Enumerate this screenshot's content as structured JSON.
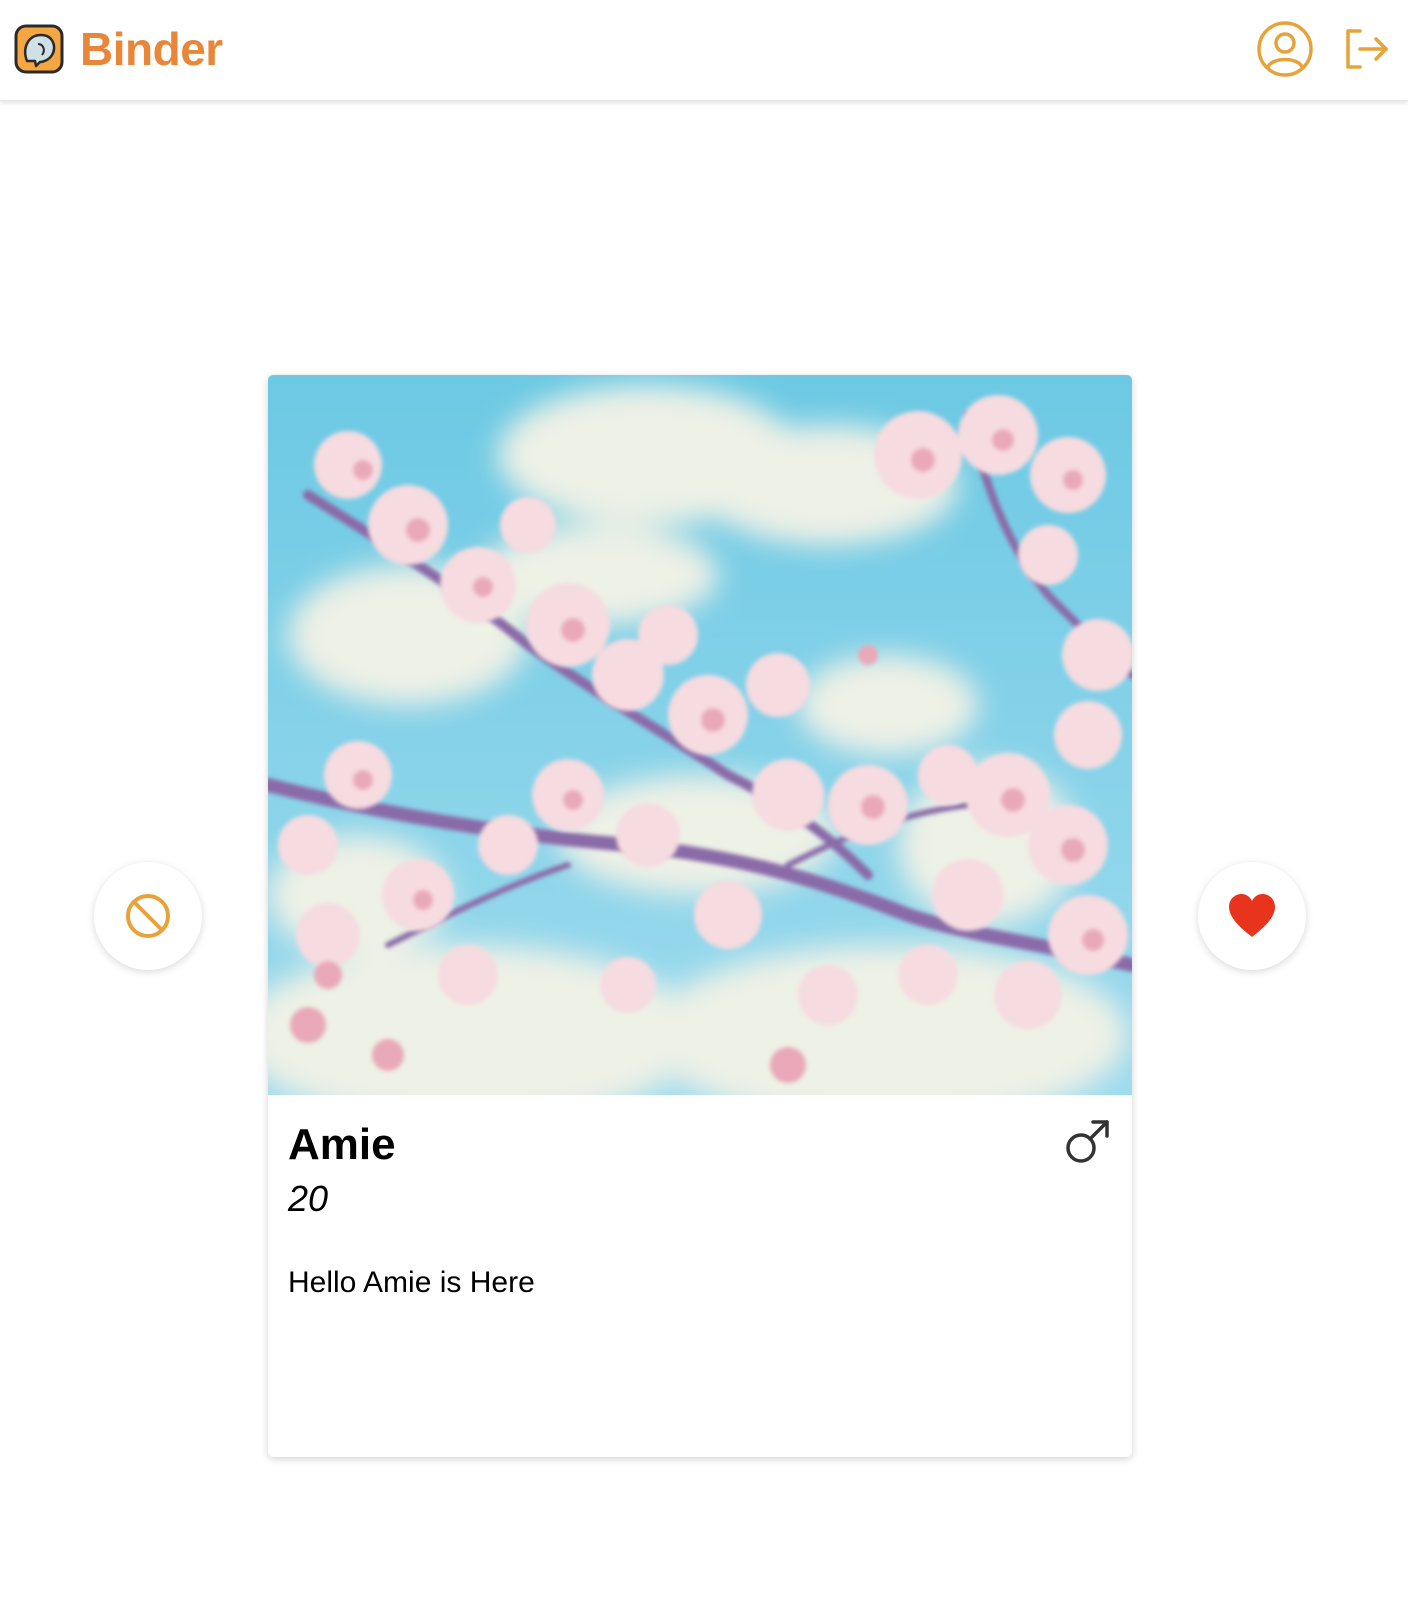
{
  "app": {
    "name": "Binder"
  },
  "header": {
    "profile_icon": "user-circle-icon",
    "logout_icon": "logout-icon"
  },
  "profile_card": {
    "name": "Amie",
    "age": "20",
    "bio": "Hello Amie is Here",
    "gender_icon": "male-symbol-icon",
    "photo": "cherry-blossom-photo"
  },
  "actions": {
    "pass_icon": "ban-icon",
    "like_icon": "heart-icon"
  },
  "colors": {
    "brand": "#E8873A",
    "accent_icon": "#E8A23A",
    "like": "#E8341C",
    "text": "#000000"
  }
}
